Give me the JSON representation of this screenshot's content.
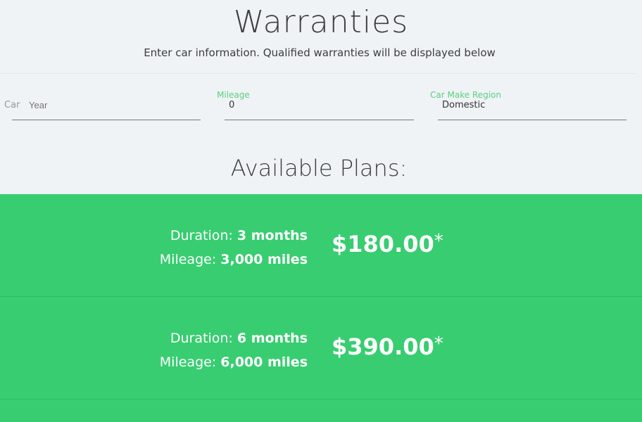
{
  "header": {
    "title": "Warranties",
    "subtitle": "Enter car information. Qualified warranties will be displayed below"
  },
  "form": {
    "car_year": {
      "label": "Car",
      "placeholder": "Year",
      "value": ""
    },
    "mileage": {
      "label": "Mileage",
      "value": "0"
    },
    "region": {
      "label": "Car Make Region",
      "value": "Domestic"
    }
  },
  "plans_heading": "Available Plans:",
  "plans": [
    {
      "duration_label": "Duration:",
      "duration": "3 months",
      "mileage_label": "Mileage:",
      "mileage": "3,000 miles",
      "price": "$180.00",
      "asterisk": "*"
    },
    {
      "duration_label": "Duration:",
      "duration": "6 months",
      "mileage_label": "Mileage:",
      "mileage": "6,000 miles",
      "price": "$390.00",
      "asterisk": "*"
    }
  ],
  "colors": {
    "accent": "#38cd71",
    "background": "#eff3f6"
  }
}
